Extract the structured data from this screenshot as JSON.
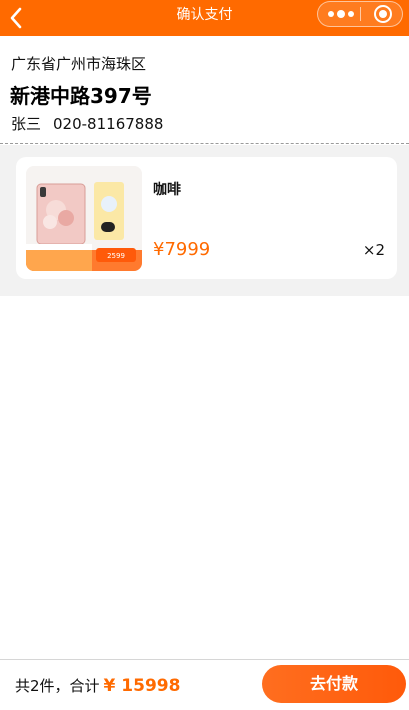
{
  "header": {
    "title": "确认支付",
    "back_icon": "chevron-left-icon",
    "capsule_icons": [
      "more-dots-icon",
      "close-target-icon"
    ]
  },
  "address": {
    "region": "广东省广州市海珠区",
    "street": "新港中路397号",
    "name": "张三",
    "phone": "020-81167888"
  },
  "product": {
    "name": "咖啡",
    "price": "¥7999",
    "quantity": "×2",
    "image_icon": "phone-product-image",
    "image_badge": "2599"
  },
  "footer": {
    "summary": "共2件，合计",
    "total": "¥ 15998",
    "pay_label": "去付款"
  },
  "colors": {
    "brand": "#ff6a00",
    "page_bg": "#f2f2f2"
  }
}
